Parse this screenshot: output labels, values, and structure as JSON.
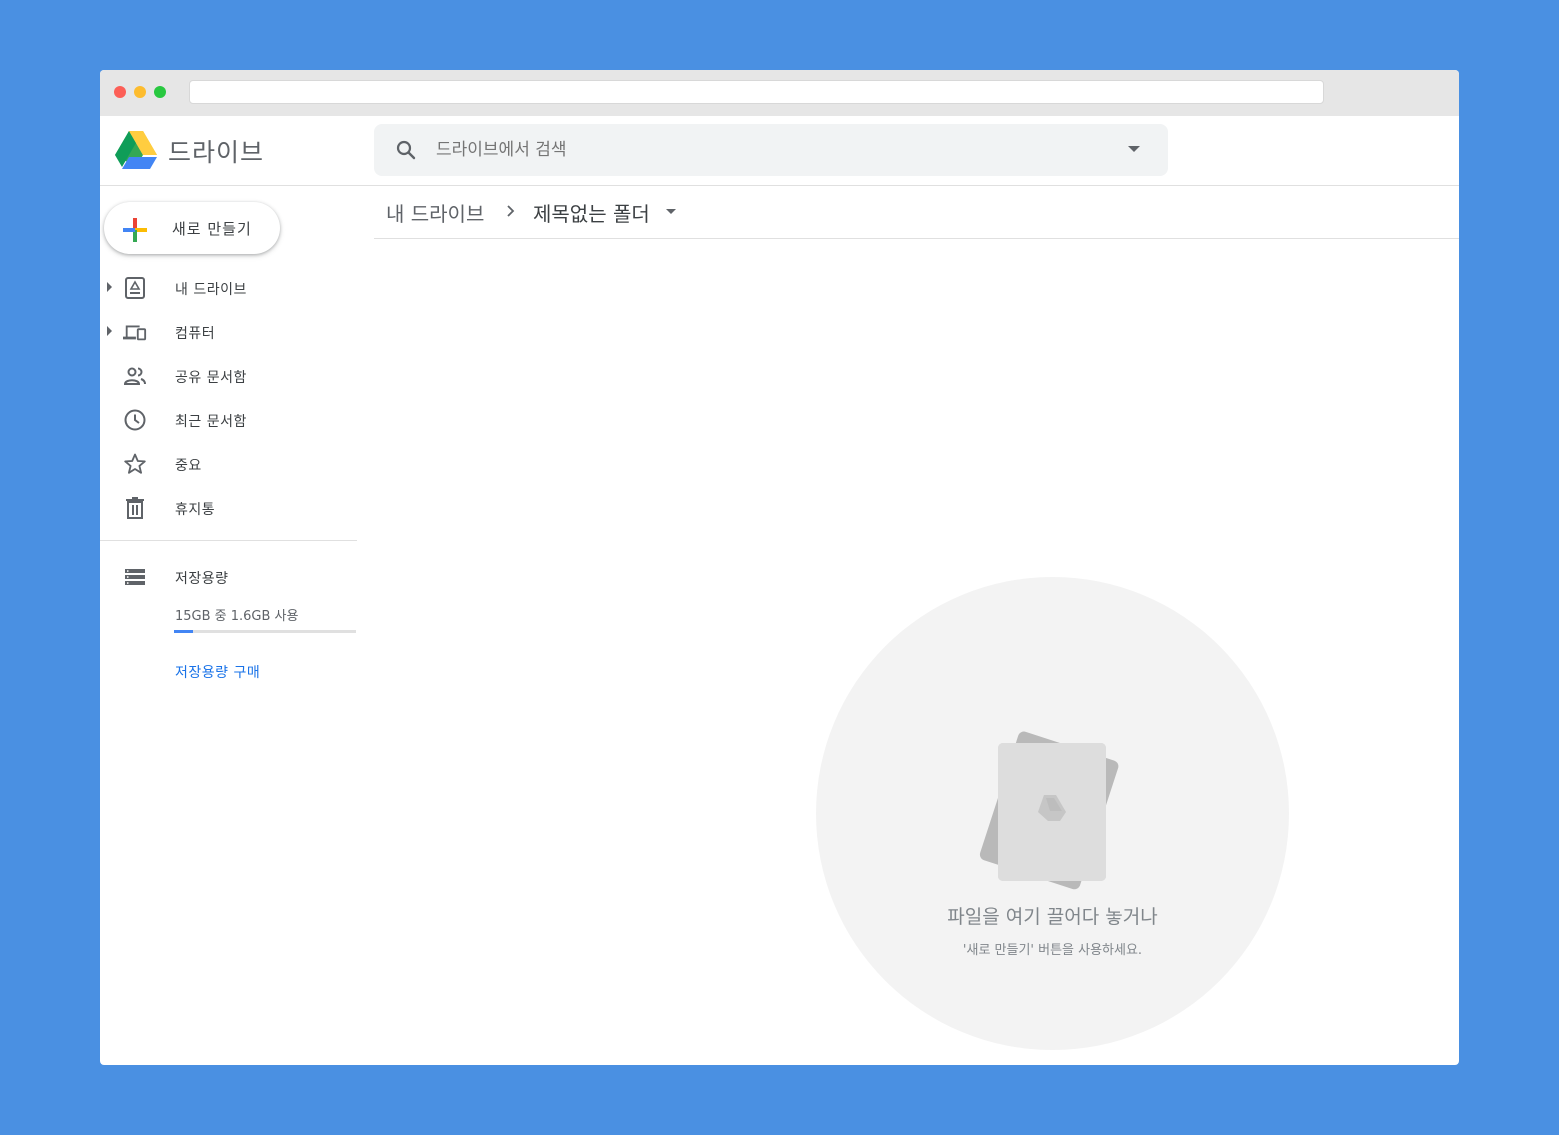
{
  "app": {
    "title": "드라이브"
  },
  "search": {
    "placeholder": "드라이브에서 검색"
  },
  "new_button": {
    "label": "새로 만들기"
  },
  "sidebar": {
    "items": [
      {
        "label": "내 드라이브",
        "icon": "my-drive-icon",
        "expandable": true
      },
      {
        "label": "컴퓨터",
        "icon": "computers-icon",
        "expandable": true
      },
      {
        "label": "공유 문서함",
        "icon": "shared-icon",
        "expandable": false
      },
      {
        "label": "최근 문서함",
        "icon": "clock-icon",
        "expandable": false
      },
      {
        "label": "중요",
        "icon": "star-icon",
        "expandable": false
      },
      {
        "label": "휴지통",
        "icon": "trash-icon",
        "expandable": false
      }
    ],
    "storage": {
      "label": "저장용량",
      "usage": "15GB 중 1.6GB 사용",
      "used_fraction": 0.107,
      "buy_label": "저장용량 구매"
    }
  },
  "breadcrumb": {
    "root": "내 드라이브",
    "current": "제목없는 폴더"
  },
  "empty_state": {
    "title": "파일을 여기 끌어다 놓거나",
    "subtitle": "'새로 만들기' 버튼을 사용하세요."
  },
  "colors": {
    "background": "#4a90e2",
    "accent": "#1a73e8",
    "storage_bar": "#4285f4"
  }
}
